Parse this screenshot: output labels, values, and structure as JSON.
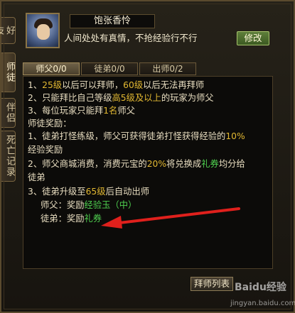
{
  "sidebar": {
    "tabs": [
      {
        "label": "好友"
      },
      {
        "label": "师徒"
      },
      {
        "label": "伴侣"
      },
      {
        "label": "死亡记录"
      }
    ]
  },
  "header": {
    "name": "饱张香怜",
    "motto": "人间处处有真情，不抢经验行不行",
    "edit_label": "修改"
  },
  "tabs": [
    {
      "label": "师父0/0"
    },
    {
      "label": "徒弟0/0"
    },
    {
      "label": "出师0/2"
    }
  ],
  "rules": {
    "r1": [
      "1、",
      "25级",
      "以后可以拜师，",
      "60级",
      "以后无法再拜师"
    ],
    "r2": [
      "2、只能拜比自己等级",
      "高5级及以上",
      "的玩家为师父"
    ],
    "r3": [
      "3、每位玩家只能拜",
      "1名",
      "师父"
    ],
    "reward_title": "师徒奖励：",
    "b1a": [
      "1、徒弟打怪练级，师父可获得徒弟打怪获得经验的",
      "10%"
    ],
    "b1b": "经验奖励",
    "b2a": [
      "2、师父商城消费，消费元宝的",
      "20%",
      "将兑换成",
      "礼券",
      "均分给"
    ],
    "b2b": "徒弟",
    "b3": [
      "3、徒弟升级至",
      "65级",
      "后自动出师"
    ],
    "b3_master": [
      "师父：奖励",
      "经验玉（中）"
    ],
    "b3_disciple": [
      "徒弟：奖励",
      "礼券"
    ]
  },
  "footer": {
    "list_label": "拜师列表"
  },
  "watermark": {
    "logo": "Baidu经验",
    "url": "jingyan.baidu.com"
  },
  "colors": {
    "highlight_yellow": "#e2b832",
    "highlight_green": "#4fd04f",
    "arrow_red": "#e0201c"
  }
}
